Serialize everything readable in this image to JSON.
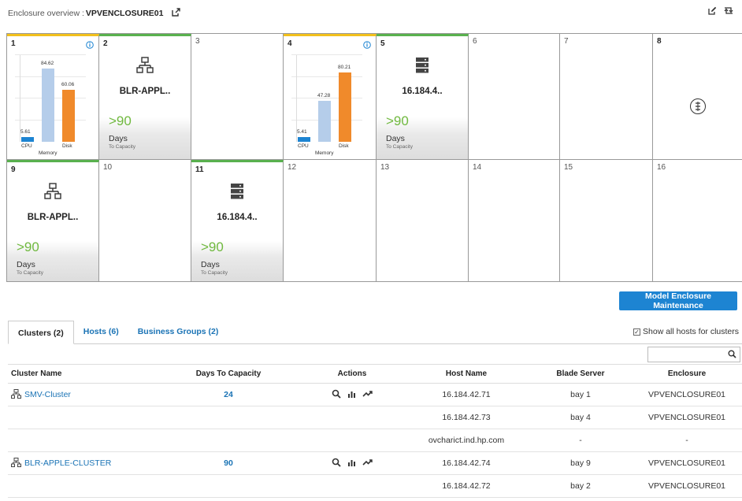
{
  "header": {
    "prefix": "Enclosure overview :",
    "name": "VPVENCLOSURE01"
  },
  "bays_row1": [
    {
      "num": "1",
      "type": "chart",
      "cpu": "5.61",
      "memory": "84.62",
      "disk": "60.06",
      "cpu_pct": 5.61,
      "memory_pct": 84.62,
      "disk_pct": 60.06
    },
    {
      "num": "2",
      "type": "host",
      "icon": "network-icon",
      "name": "BLR-APPL..",
      "capacity": ">90",
      "cap_label": "Days",
      "cap_sub": "To Capacity"
    },
    {
      "num": "3",
      "type": "empty"
    },
    {
      "num": "4",
      "type": "chart",
      "cpu": "5.41",
      "memory": "47.28",
      "disk": "80.21",
      "cpu_pct": 5.41,
      "memory_pct": 47.28,
      "disk_pct": 80.21
    },
    {
      "num": "5",
      "type": "host",
      "icon": "server-icon",
      "name": "16.184.4..",
      "capacity": ">90",
      "cap_label": "Days",
      "cap_sub": "To Capacity"
    },
    {
      "num": "6",
      "type": "empty"
    },
    {
      "num": "7",
      "type": "empty"
    },
    {
      "num": "8",
      "type": "maintenance"
    }
  ],
  "bays_row2": [
    {
      "num": "9",
      "type": "host",
      "icon": "network-icon",
      "name": "BLR-APPL..",
      "capacity": ">90",
      "cap_label": "Days",
      "cap_sub": "To Capacity"
    },
    {
      "num": "10",
      "type": "empty"
    },
    {
      "num": "11",
      "type": "host",
      "icon": "server-icon",
      "name": "16.184.4..",
      "capacity": ">90",
      "cap_label": "Days",
      "cap_sub": "To Capacity"
    },
    {
      "num": "12",
      "type": "empty"
    },
    {
      "num": "13",
      "type": "empty"
    },
    {
      "num": "14",
      "type": "empty"
    },
    {
      "num": "15",
      "type": "empty"
    },
    {
      "num": "16",
      "type": "empty"
    }
  ],
  "chart_labels": {
    "cpu": "CPU",
    "memory": "Memory",
    "disk": "Disk"
  },
  "chart_colors": {
    "cpu": "#1d84d2",
    "memory": "#b5cdea",
    "disk": "#f08a2b"
  },
  "model_button": "Model Enclosure Maintenance",
  "tabs": [
    {
      "label": "Clusters (2)",
      "active": true
    },
    {
      "label": "Hosts (6)",
      "active": false
    },
    {
      "label": "Business Groups (2)",
      "active": false
    }
  ],
  "show_all": "Show all hosts for clusters",
  "search": {
    "value": "",
    "placeholder": ""
  },
  "table": {
    "headers": [
      "Cluster Name",
      "Days To Capacity",
      "Actions",
      "Host Name",
      "Blade Server",
      "Enclosure"
    ],
    "rows": [
      {
        "cluster": "SMV-Cluster",
        "days": "24",
        "actions": true,
        "host": "16.184.42.71",
        "blade": "bay 1",
        "enclosure": "VPVENCLOSURE01"
      },
      {
        "cluster": "",
        "days": "",
        "actions": false,
        "host": "16.184.42.73",
        "blade": "bay 4",
        "enclosure": "VPVENCLOSURE01"
      },
      {
        "cluster": "",
        "days": "",
        "actions": false,
        "host": "ovcharict.ind.hp.com",
        "blade": "-",
        "enclosure": "-"
      },
      {
        "cluster": "BLR-APPLE-CLUSTER",
        "days": "90",
        "actions": true,
        "host": "16.184.42.74",
        "blade": "bay 9",
        "enclosure": "VPVENCLOSURE01"
      },
      {
        "cluster": "",
        "days": "",
        "actions": false,
        "host": "16.184.42.72",
        "blade": "bay 2",
        "enclosure": "VPVENCLOSURE01"
      }
    ]
  }
}
